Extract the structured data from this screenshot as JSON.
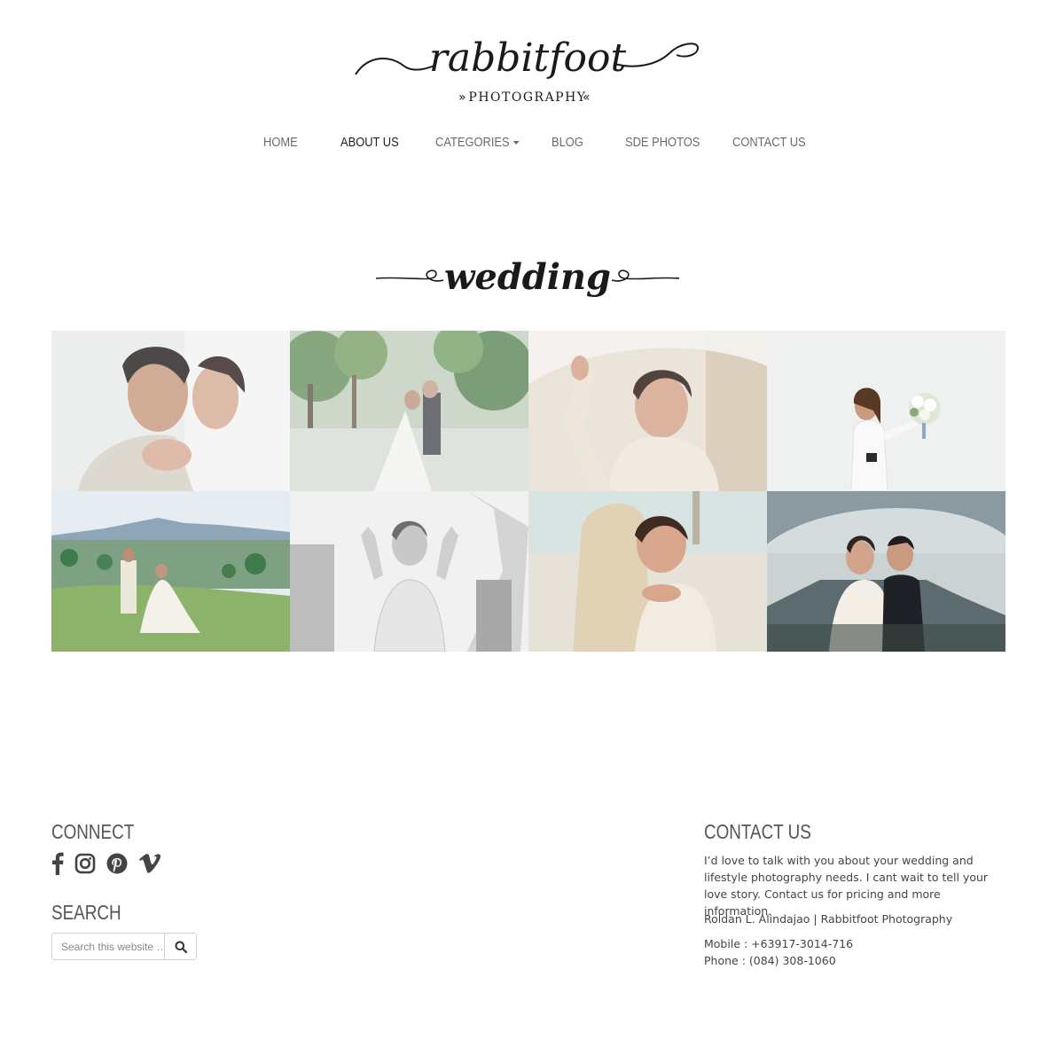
{
  "header": {
    "logo_text": "rabbitfoot",
    "logo_subtext": "PHOTOGRAPHY"
  },
  "nav": {
    "items": [
      {
        "label": "HOME"
      },
      {
        "label": "ABOUT US"
      },
      {
        "label": "CATEGORIES"
      },
      {
        "label": "BLOG"
      },
      {
        "label": "SDE PHOTOS"
      },
      {
        "label": "CONTACT US"
      }
    ],
    "active": "ABOUT US"
  },
  "main": {
    "section_title": "wedding",
    "gallery": [
      {
        "subject": "couple close-up with veil"
      },
      {
        "subject": "couple among tropical trees"
      },
      {
        "subject": "bride smiling under veil"
      },
      {
        "subject": "bride holding bouquet"
      },
      {
        "subject": "couple on hillside with mountain"
      },
      {
        "subject": "bride with bridesmaids black and white"
      },
      {
        "subject": "couple embracing on beach"
      },
      {
        "subject": "couple under veil at dusk"
      }
    ]
  },
  "footer": {
    "connect": {
      "title": "CONNECT",
      "icons": [
        "facebook-icon",
        "instagram-icon",
        "pinterest-icon",
        "vimeo-icon"
      ]
    },
    "search": {
      "title": "SEARCH",
      "placeholder": "Search this website …",
      "icon": "search-icon"
    },
    "contact": {
      "title": "CONTACT US",
      "intro": "I’d love to talk with you about your wedding and lifestyle photography needs. I cant wait to tell your love story. Contact us for pricing and more information.",
      "name": "Roldan L. Alindajao | Rabbitfoot Photography",
      "mobile": "Mobile : +63917-3014-716",
      "phone": "Phone : (084) 308-1060"
    }
  },
  "colors": {
    "nav_text": "#6b6b6b",
    "nav_active": "#222222",
    "heading": "#555555",
    "body_text": "#444444"
  }
}
